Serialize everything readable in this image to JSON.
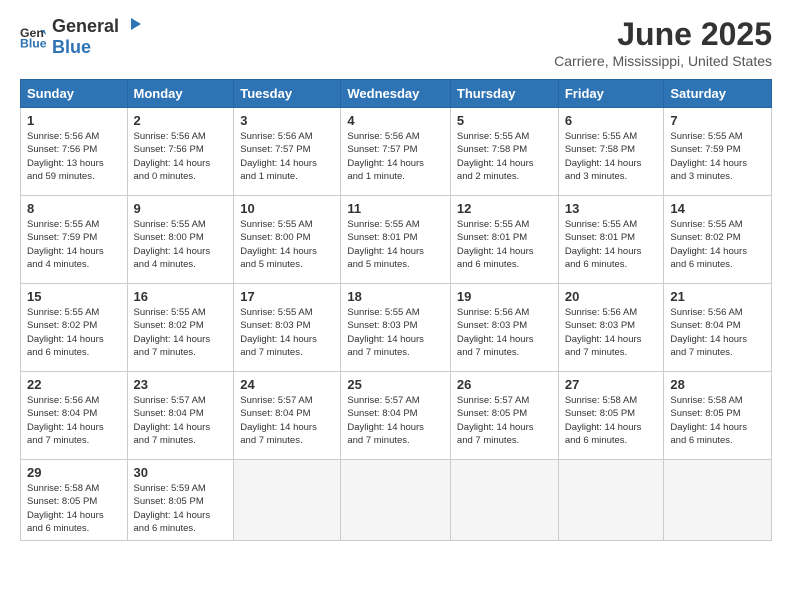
{
  "logo": {
    "general": "General",
    "blue": "Blue"
  },
  "title": "June 2025",
  "location": "Carriere, Mississippi, United States",
  "days_header": [
    "Sunday",
    "Monday",
    "Tuesday",
    "Wednesday",
    "Thursday",
    "Friday",
    "Saturday"
  ],
  "weeks": [
    [
      {
        "day": "1",
        "detail": "Sunrise: 5:56 AM\nSunset: 7:56 PM\nDaylight: 13 hours\nand 59 minutes."
      },
      {
        "day": "2",
        "detail": "Sunrise: 5:56 AM\nSunset: 7:56 PM\nDaylight: 14 hours\nand 0 minutes."
      },
      {
        "day": "3",
        "detail": "Sunrise: 5:56 AM\nSunset: 7:57 PM\nDaylight: 14 hours\nand 1 minute."
      },
      {
        "day": "4",
        "detail": "Sunrise: 5:56 AM\nSunset: 7:57 PM\nDaylight: 14 hours\nand 1 minute."
      },
      {
        "day": "5",
        "detail": "Sunrise: 5:55 AM\nSunset: 7:58 PM\nDaylight: 14 hours\nand 2 minutes."
      },
      {
        "day": "6",
        "detail": "Sunrise: 5:55 AM\nSunset: 7:58 PM\nDaylight: 14 hours\nand 3 minutes."
      },
      {
        "day": "7",
        "detail": "Sunrise: 5:55 AM\nSunset: 7:59 PM\nDaylight: 14 hours\nand 3 minutes."
      }
    ],
    [
      {
        "day": "8",
        "detail": "Sunrise: 5:55 AM\nSunset: 7:59 PM\nDaylight: 14 hours\nand 4 minutes."
      },
      {
        "day": "9",
        "detail": "Sunrise: 5:55 AM\nSunset: 8:00 PM\nDaylight: 14 hours\nand 4 minutes."
      },
      {
        "day": "10",
        "detail": "Sunrise: 5:55 AM\nSunset: 8:00 PM\nDaylight: 14 hours\nand 5 minutes."
      },
      {
        "day": "11",
        "detail": "Sunrise: 5:55 AM\nSunset: 8:01 PM\nDaylight: 14 hours\nand 5 minutes."
      },
      {
        "day": "12",
        "detail": "Sunrise: 5:55 AM\nSunset: 8:01 PM\nDaylight: 14 hours\nand 6 minutes."
      },
      {
        "day": "13",
        "detail": "Sunrise: 5:55 AM\nSunset: 8:01 PM\nDaylight: 14 hours\nand 6 minutes."
      },
      {
        "day": "14",
        "detail": "Sunrise: 5:55 AM\nSunset: 8:02 PM\nDaylight: 14 hours\nand 6 minutes."
      }
    ],
    [
      {
        "day": "15",
        "detail": "Sunrise: 5:55 AM\nSunset: 8:02 PM\nDaylight: 14 hours\nand 6 minutes."
      },
      {
        "day": "16",
        "detail": "Sunrise: 5:55 AM\nSunset: 8:02 PM\nDaylight: 14 hours\nand 7 minutes."
      },
      {
        "day": "17",
        "detail": "Sunrise: 5:55 AM\nSunset: 8:03 PM\nDaylight: 14 hours\nand 7 minutes."
      },
      {
        "day": "18",
        "detail": "Sunrise: 5:55 AM\nSunset: 8:03 PM\nDaylight: 14 hours\nand 7 minutes."
      },
      {
        "day": "19",
        "detail": "Sunrise: 5:56 AM\nSunset: 8:03 PM\nDaylight: 14 hours\nand 7 minutes."
      },
      {
        "day": "20",
        "detail": "Sunrise: 5:56 AM\nSunset: 8:03 PM\nDaylight: 14 hours\nand 7 minutes."
      },
      {
        "day": "21",
        "detail": "Sunrise: 5:56 AM\nSunset: 8:04 PM\nDaylight: 14 hours\nand 7 minutes."
      }
    ],
    [
      {
        "day": "22",
        "detail": "Sunrise: 5:56 AM\nSunset: 8:04 PM\nDaylight: 14 hours\nand 7 minutes."
      },
      {
        "day": "23",
        "detail": "Sunrise: 5:57 AM\nSunset: 8:04 PM\nDaylight: 14 hours\nand 7 minutes."
      },
      {
        "day": "24",
        "detail": "Sunrise: 5:57 AM\nSunset: 8:04 PM\nDaylight: 14 hours\nand 7 minutes."
      },
      {
        "day": "25",
        "detail": "Sunrise: 5:57 AM\nSunset: 8:04 PM\nDaylight: 14 hours\nand 7 minutes."
      },
      {
        "day": "26",
        "detail": "Sunrise: 5:57 AM\nSunset: 8:05 PM\nDaylight: 14 hours\nand 7 minutes."
      },
      {
        "day": "27",
        "detail": "Sunrise: 5:58 AM\nSunset: 8:05 PM\nDaylight: 14 hours\nand 6 minutes."
      },
      {
        "day": "28",
        "detail": "Sunrise: 5:58 AM\nSunset: 8:05 PM\nDaylight: 14 hours\nand 6 minutes."
      }
    ],
    [
      {
        "day": "29",
        "detail": "Sunrise: 5:58 AM\nSunset: 8:05 PM\nDaylight: 14 hours\nand 6 minutes."
      },
      {
        "day": "30",
        "detail": "Sunrise: 5:59 AM\nSunset: 8:05 PM\nDaylight: 14 hours\nand 6 minutes."
      },
      null,
      null,
      null,
      null,
      null
    ]
  ]
}
